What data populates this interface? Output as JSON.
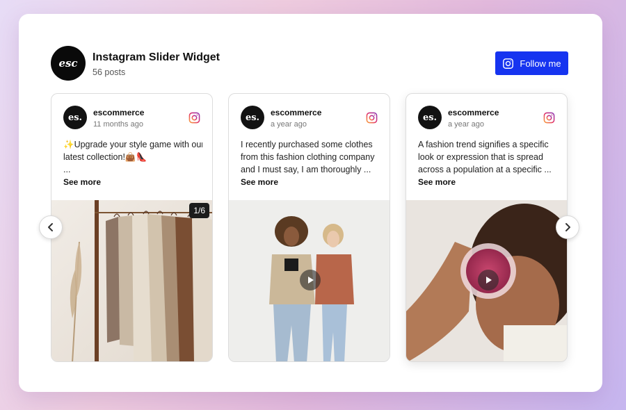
{
  "widget": {
    "title": "Instagram Slider Widget",
    "posts_count": "56 posts",
    "logo_text": "esc",
    "follow_label": "Follow me",
    "accent_color": "#1634f0"
  },
  "posts": [
    {
      "avatar_text": "es.",
      "username": "escommerce",
      "time": "11 months ago",
      "caption_lines": [
        "✨Upgrade your style game with our",
        "latest collection!👜👠",
        "..."
      ],
      "see_more": "See more",
      "media_counter": "1/6",
      "media_type": "image"
    },
    {
      "avatar_text": "es.",
      "username": "escommerce",
      "time": "a year ago",
      "caption_lines": [
        "I recently purchased some clothes",
        "from this fashion clothing company",
        "and I must say, I am thoroughly ..."
      ],
      "see_more": "See more",
      "media_type": "video"
    },
    {
      "avatar_text": "es.",
      "username": "escommerce",
      "time": "a year ago",
      "caption_lines": [
        "A fashion trend signifies a specific",
        "look or expression that is spread",
        "across a population at a specific ..."
      ],
      "see_more": "See more",
      "media_type": "video"
    }
  ],
  "icons": {
    "platform": "instagram-icon",
    "prev": "chevron-left-icon",
    "next": "chevron-right-icon",
    "play": "play-icon"
  }
}
